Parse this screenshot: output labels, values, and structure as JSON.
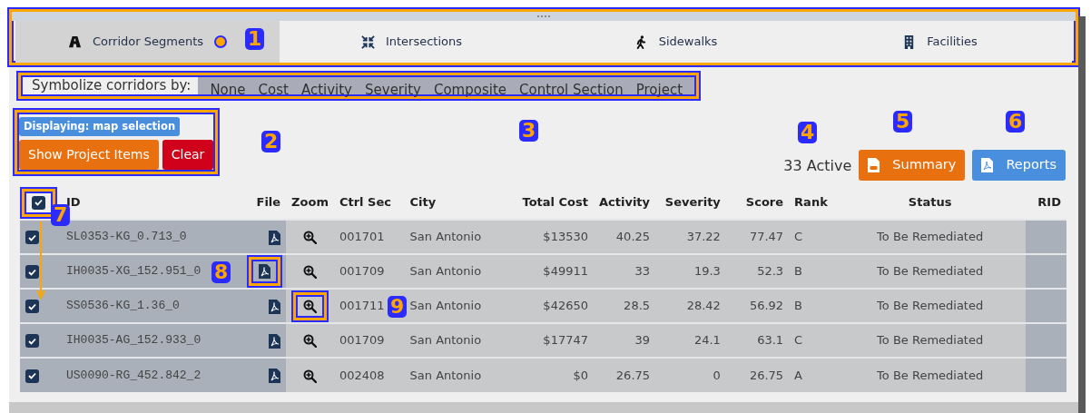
{
  "tabs": [
    {
      "label": "Corridor Segments",
      "selected": true
    },
    {
      "label": "Intersections",
      "selected": false
    },
    {
      "label": "Sidewalks",
      "selected": false
    },
    {
      "label": "Facilities",
      "selected": false
    }
  ],
  "symbolize": {
    "label": "Symbolize corridors by:",
    "options": [
      {
        "label": "None",
        "selected": false
      },
      {
        "label": "Cost",
        "selected": false
      },
      {
        "label": "Activity",
        "selected": false
      },
      {
        "label": "Severity",
        "selected": false
      },
      {
        "label": "Composite",
        "selected": false
      },
      {
        "label": "Control Section",
        "selected": false
      },
      {
        "label": "Project",
        "selected": false
      }
    ]
  },
  "display_badge": "Displaying: map selection",
  "buttons": [
    "Show Project Items",
    "Clear"
  ],
  "active_count": "33 Active",
  "export_buttons": [
    {
      "label": "Summary",
      "kind": "csv"
    },
    {
      "label": "Reports",
      "kind": "pdf"
    }
  ],
  "table": {
    "select_all_checked": true,
    "columns": [
      "ID",
      "File",
      "Zoom",
      "Ctrl Sec",
      "City",
      "Total Cost",
      "Activity",
      "Severity",
      "Score",
      "Rank",
      "Status",
      "RID"
    ],
    "rows": [
      {
        "checked": true,
        "id": "SL0353-KG_0.713_0",
        "ctrl_sec": "001701",
        "city": "San Antonio",
        "total_cost": "$13530",
        "activity": "40.25",
        "severity": "37.22",
        "score": "77.47",
        "rank": "C",
        "status": "To Be Remediated"
      },
      {
        "checked": true,
        "id": "IH0035-XG_152.951_0",
        "ctrl_sec": "001709",
        "city": "San Antonio",
        "total_cost": "$49911",
        "activity": "33",
        "severity": "19.3",
        "score": "52.3",
        "rank": "B",
        "status": "To Be Remediated"
      },
      {
        "checked": true,
        "id": "SS0536-KG_1.36_0",
        "ctrl_sec": "001711",
        "city": "San Antonio",
        "total_cost": "$42650",
        "activity": "28.5",
        "severity": "28.42",
        "score": "56.92",
        "rank": "B",
        "status": "To Be Remediated"
      },
      {
        "checked": true,
        "id": "IH0035-AG_152.933_0",
        "ctrl_sec": "001709",
        "city": "San Antonio",
        "total_cost": "$17747",
        "activity": "39",
        "severity": "24.1",
        "score": "63.1",
        "rank": "C",
        "status": "To Be Remediated"
      },
      {
        "checked": true,
        "id": "US0090-RG_452.842_2",
        "ctrl_sec": "002408",
        "city": "San Antonio",
        "total_cost": "$0",
        "activity": "26.75",
        "severity": "0",
        "score": "26.75",
        "rank": "A",
        "status": "To Be Remediated"
      }
    ]
  },
  "annotations": [
    {
      "label": "1"
    },
    {
      "label": "2"
    },
    {
      "label": "3"
    },
    {
      "label": "4"
    },
    {
      "label": "5"
    },
    {
      "label": "6"
    },
    {
      "label": "7"
    },
    {
      "label": "8"
    },
    {
      "label": "9"
    }
  ]
}
